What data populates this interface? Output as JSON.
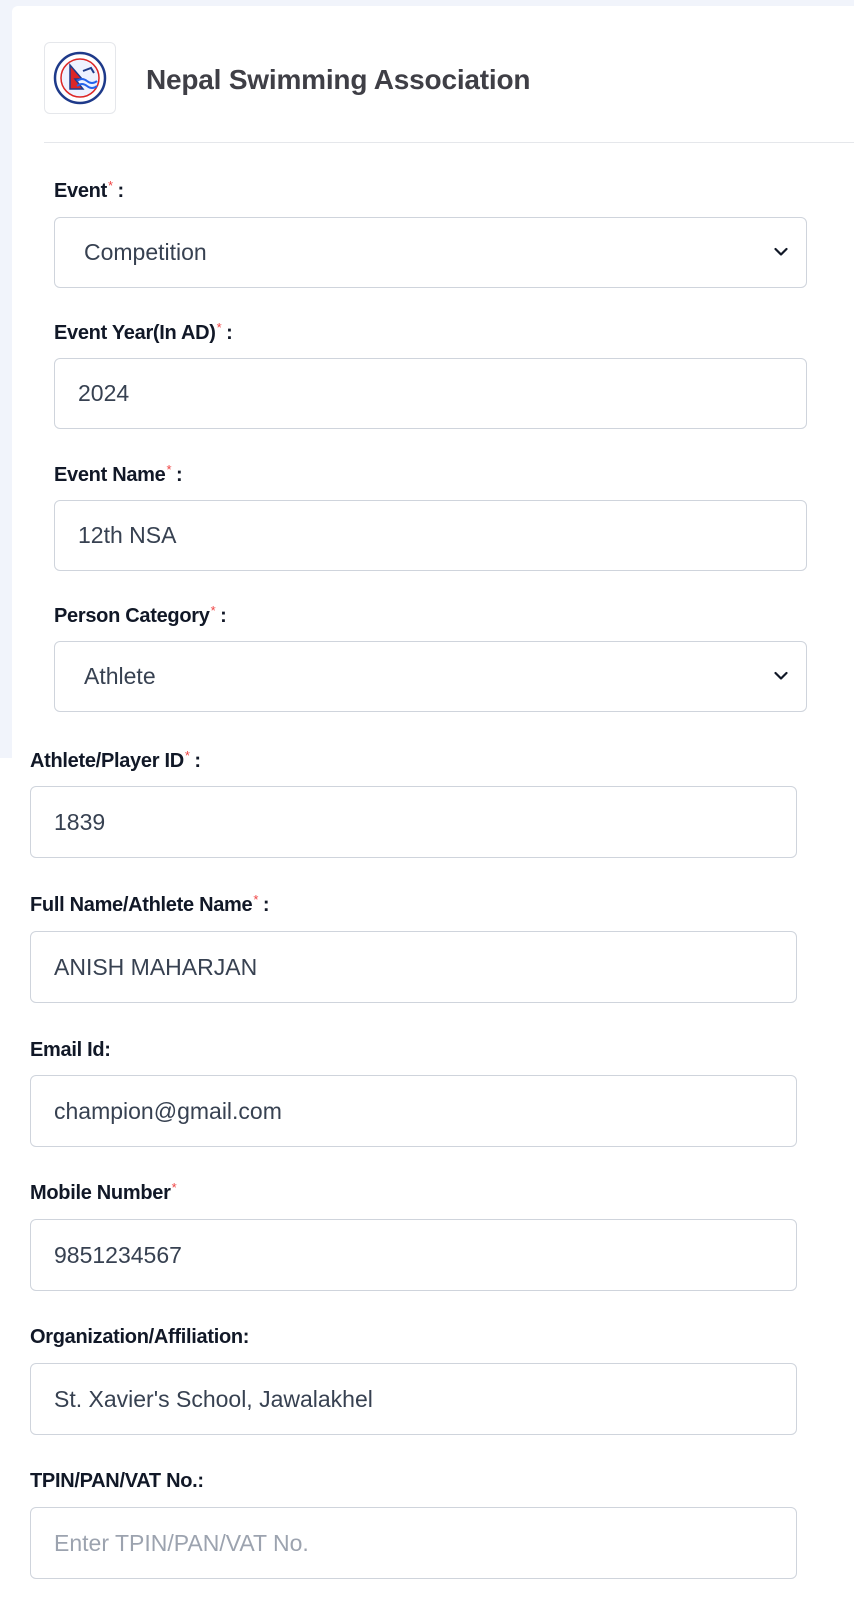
{
  "brand": {
    "title": "Nepal Swimming Association",
    "logo_icon": "nepal-swimming-association-logo"
  },
  "colors": {
    "required_marker": "#ef4444",
    "page_background": "#f1f4fb",
    "border": "#cfd4dc"
  },
  "form": {
    "required_marker": "*",
    "colon": ":",
    "event": {
      "label": "Event",
      "value": "Competition"
    },
    "event_year": {
      "label": "Event Year(In AD)",
      "value": "2024"
    },
    "event_name": {
      "label": "Event Name",
      "value": "12th NSA"
    },
    "person_category": {
      "label": "Person Category",
      "value": "Athlete"
    },
    "athlete_id": {
      "label": "Athlete/Player ID",
      "value": "1839"
    },
    "full_name": {
      "label": "Full Name/Athlete Name",
      "value": "ANISH MAHARJAN"
    },
    "email": {
      "label": "Email Id:",
      "value": "champion@gmail.com"
    },
    "mobile": {
      "label": "Mobile Number",
      "value": "9851234567"
    },
    "organization": {
      "label": "Organization/Affiliation:",
      "value": "St. Xavier's School, Jawalakhel"
    },
    "tpin": {
      "label": "TPIN/PAN/VAT No.:",
      "placeholder": "Enter TPIN/PAN/VAT No."
    }
  }
}
